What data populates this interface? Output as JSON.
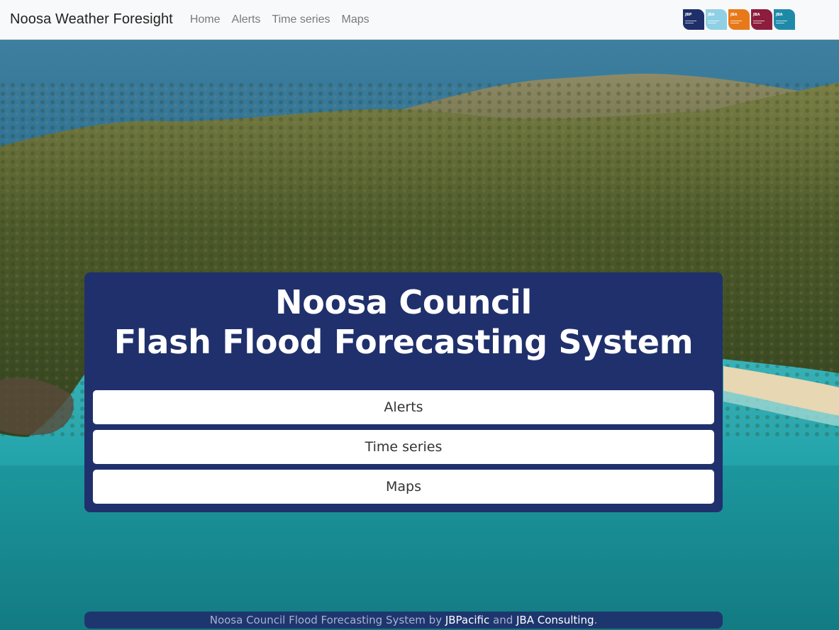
{
  "navbar": {
    "brand": "Noosa Weather Foresight",
    "links": [
      "Home",
      "Alerts",
      "Time series",
      "Maps"
    ],
    "logos": [
      {
        "label": "JBP",
        "color": "#1f2f6a"
      },
      {
        "label": "JBA",
        "color": "#8fd0e4"
      },
      {
        "label": "JBA",
        "color": "#e8791b"
      },
      {
        "label": "JBA",
        "color": "#8d1d3d"
      },
      {
        "label": "JBA",
        "color": "#1f8aa8"
      }
    ]
  },
  "hero": {
    "title_line1": "Noosa Council",
    "title_line2": "Flash Flood Forecasting System",
    "buttons": [
      "Alerts",
      "Time series",
      "Maps"
    ]
  },
  "footer": {
    "prefix": "Noosa Council Flood Forecasting System by ",
    "link1": "JBPacific",
    "middle": " and ",
    "link2": "JBA Consulting",
    "suffix": "."
  },
  "colors": {
    "navbar_bg": "#f8f9fa",
    "hero_bg": "#20306c",
    "button_bg": "#ffffff"
  }
}
